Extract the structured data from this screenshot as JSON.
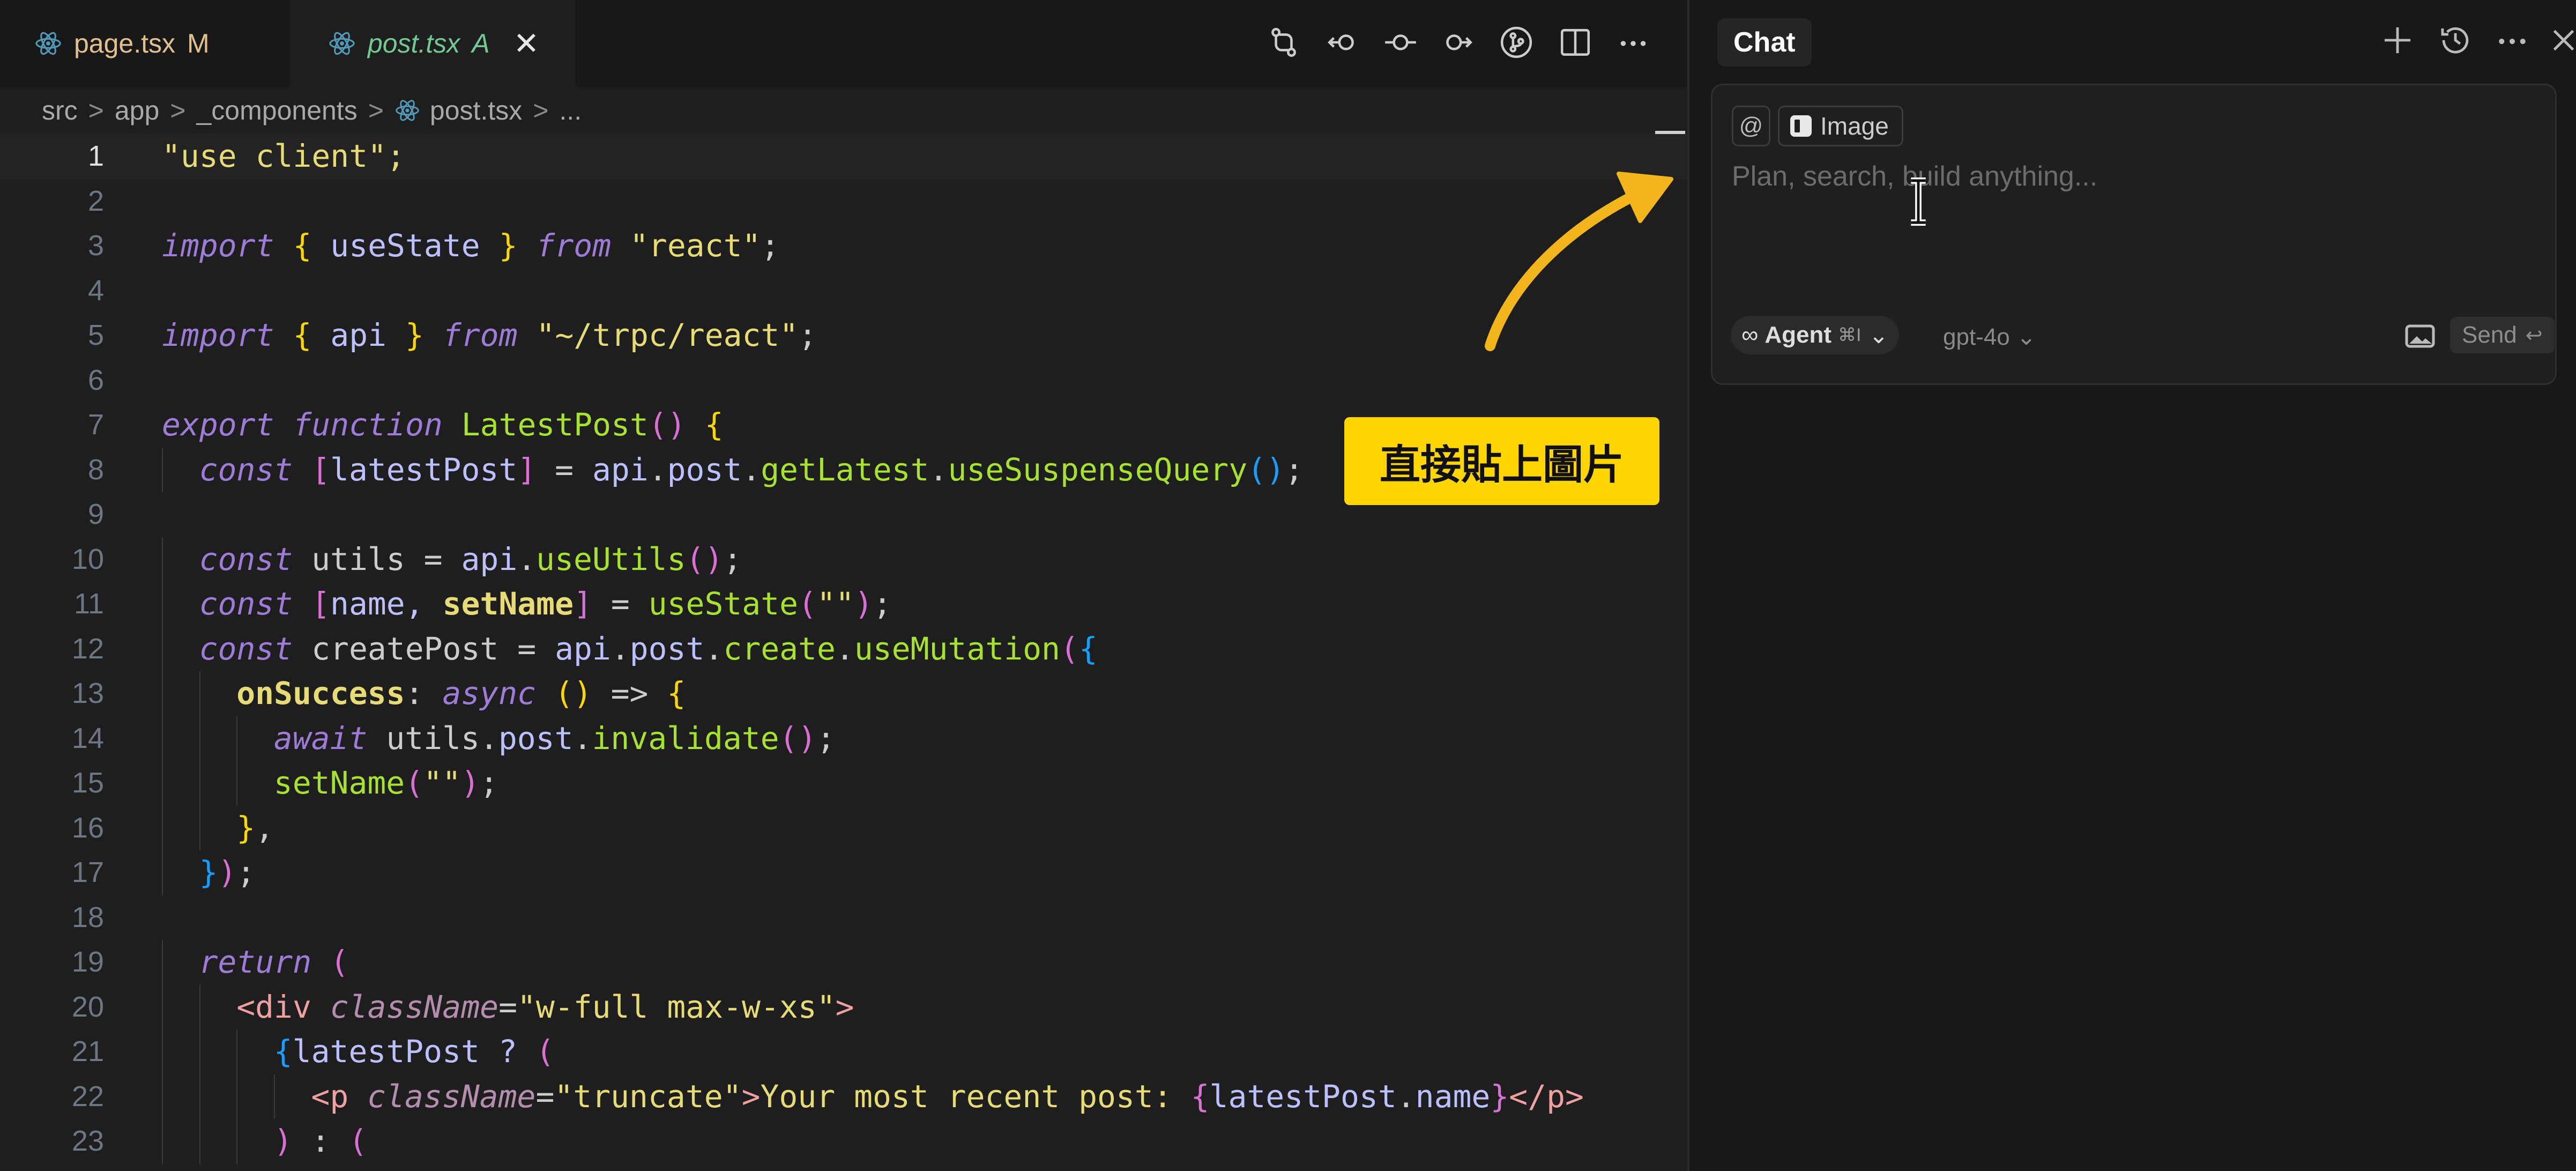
{
  "tabs": [
    {
      "label": "page.tsx",
      "badge": "M"
    },
    {
      "label": "post.tsx",
      "badge": "A",
      "close": "✕"
    }
  ],
  "toolbar_icons": [
    "git-compare-icon",
    "go-back-icon",
    "git-commit-icon",
    "go-forward-icon",
    "source-control-graph-icon",
    "split-editor-icon",
    "more-actions-icon"
  ],
  "breadcrumb": {
    "items": [
      "src",
      "app",
      "_components",
      "post.tsx",
      "..."
    ],
    "separator": ">"
  },
  "code": {
    "line_numbers": [
      "1",
      "2",
      "3",
      "4",
      "5",
      "6",
      "7",
      "8",
      "9",
      "10",
      "11",
      "12",
      "13",
      "14",
      "15",
      "16",
      "17",
      "18",
      "19",
      "20",
      "21",
      "22",
      "23"
    ],
    "current_line": "1",
    "lines": [
      [
        "\"use client\";"
      ],
      [
        ""
      ],
      [
        "import",
        " ",
        "{",
        " useState ",
        "}",
        " ",
        "from",
        " ",
        "\"react\"",
        ";"
      ],
      [
        ""
      ],
      [
        "import",
        " ",
        "{",
        " api ",
        "}",
        " ",
        "from",
        " ",
        "\"~/trpc/react\"",
        ";"
      ],
      [
        ""
      ],
      [
        "export",
        " ",
        "function",
        " ",
        "LatestPost",
        "()",
        " ",
        "{"
      ],
      [
        "const",
        " ",
        "[",
        "latestPost",
        "]",
        " = ",
        "api",
        ".",
        "post",
        ".",
        "getLatest",
        ".",
        "useSuspenseQuery",
        "()",
        ";"
      ],
      [
        ""
      ],
      [
        "const",
        " utils = ",
        "api",
        ".",
        "useUtils",
        "()",
        ";"
      ],
      [
        "const",
        " ",
        "[",
        "name, ",
        "setName",
        "]",
        " = ",
        "useState",
        "(",
        "\"\"",
        ")",
        ";"
      ],
      [
        "const",
        " createPost = ",
        "api",
        ".",
        "post",
        ".",
        "create",
        ".",
        "useMutation",
        "(",
        "{"
      ],
      [
        "onSuccess",
        ": ",
        "async",
        " ",
        "()",
        " => ",
        "{"
      ],
      [
        "await",
        " utils.",
        "post",
        ".",
        "invalidate",
        "()",
        ";"
      ],
      [
        "setName",
        "(",
        "\"\"",
        ")",
        ";"
      ],
      [
        "}",
        ","
      ],
      [
        "}",
        ")",
        ";"
      ],
      [
        ""
      ],
      [
        "return",
        " ",
        "("
      ],
      [
        "<",
        "div",
        " ",
        "className",
        "=",
        "\"w-full max-w-xs\"",
        ">"
      ],
      [
        "{",
        "latestPost ? ",
        "("
      ],
      [
        "<",
        "p",
        " ",
        "className",
        "=",
        "\"truncate\"",
        ">",
        "Your most recent post: ",
        "{",
        "latestPost",
        ".",
        "name",
        "}",
        "</",
        "p",
        ">"
      ],
      [
        ")",
        " : ",
        "("
      ]
    ]
  },
  "annotation": {
    "callout_text": "直接貼上圖片",
    "color": "#ffd600"
  },
  "chat": {
    "title": "Chat",
    "header_icons": [
      "add-icon",
      "history-icon",
      "more-icon",
      "close-icon"
    ],
    "mention_chip": "@",
    "image_chip": "Image",
    "prompt_placeholder": "Plan, search, build anything...",
    "agent": {
      "label": "Agent",
      "shortcut": "⌘I",
      "icon": "infinity-icon"
    },
    "model": "gpt-4o",
    "send": {
      "label": "Send",
      "key": "↩"
    }
  }
}
